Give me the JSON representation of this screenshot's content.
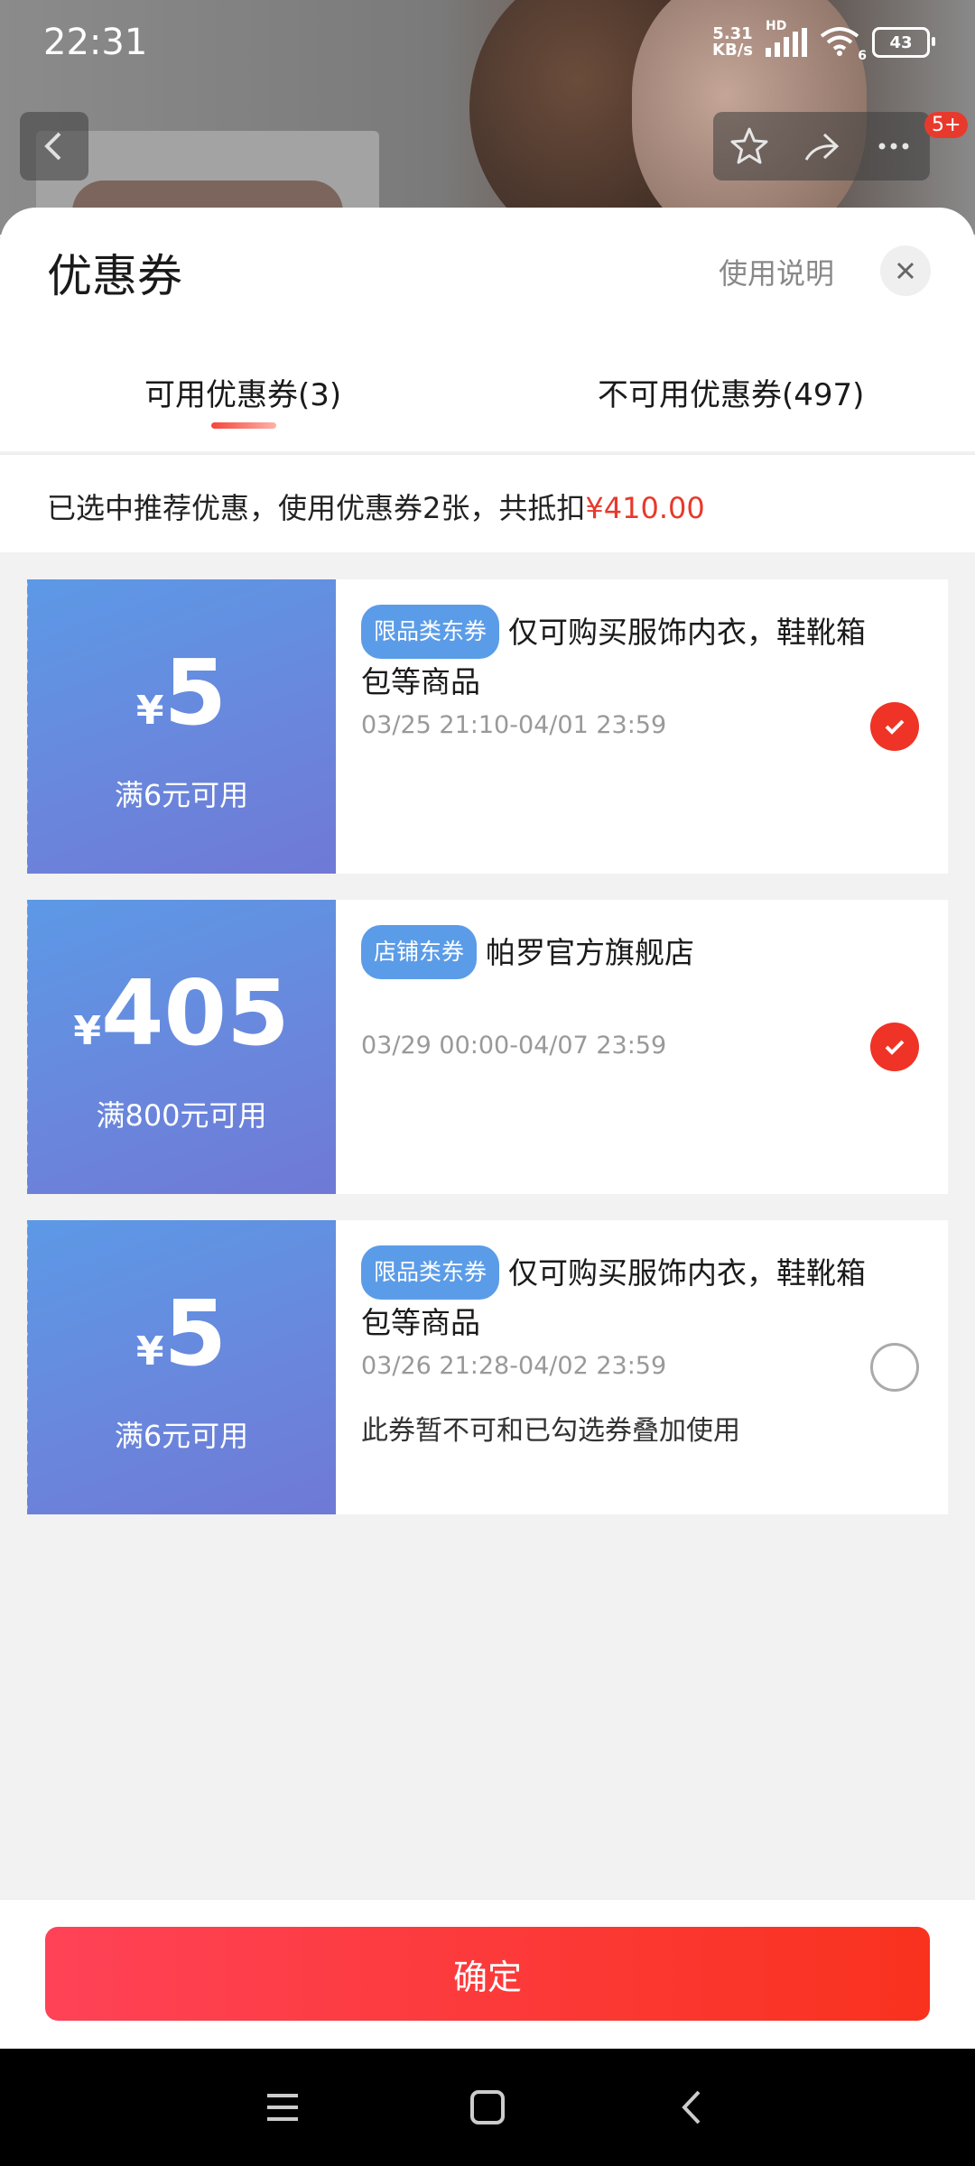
{
  "status_bar": {
    "time": "22:31",
    "net_speed_value": "5.31",
    "net_speed_unit": "KB/s",
    "hd_label": "HD",
    "wifi_sub": "6",
    "battery": "43"
  },
  "page_nav": {
    "back_icon": "chevron-left-icon",
    "star_icon": "star-icon",
    "share_icon": "share-icon",
    "more_icon": "more-icon",
    "badge": "5+"
  },
  "sheet": {
    "title": "优惠券",
    "help_label": "使用说明",
    "tabs": [
      {
        "label": "可用优惠券(3)",
        "active": true
      },
      {
        "label": "不可用优惠券(497)",
        "active": false
      }
    ],
    "summary_text": "已选中推荐优惠，使用优惠券2张，共抵扣",
    "summary_amount": "¥410.00"
  },
  "coupons": [
    {
      "currency": "¥",
      "amount": "5",
      "condition": "满6元可用",
      "tag": "限品类东券",
      "title": "仅可购买服饰内衣，鞋靴箱包等商品",
      "date": "03/25 21:10-04/01 23:59",
      "note": "",
      "checked": true
    },
    {
      "currency": "¥",
      "amount": "405",
      "condition": "满800元可用",
      "tag": "店铺东券",
      "title": "帕罗官方旗舰店",
      "date": "03/29 00:00-04/07 23:59",
      "note": "",
      "checked": true
    },
    {
      "currency": "¥",
      "amount": "5",
      "condition": "满6元可用",
      "tag": "限品类东券",
      "title": "仅可购买服饰内衣，鞋靴箱包等商品",
      "date": "03/26 21:28-04/02 23:59",
      "note": "此券暂不可和已勾选券叠加使用",
      "checked": false
    }
  ],
  "footer": {
    "confirm_label": "确定"
  },
  "colors": {
    "accent_red": "#ef3326",
    "coupon_blue": "#5c99e6",
    "tag_blue": "#5b9ce8"
  }
}
